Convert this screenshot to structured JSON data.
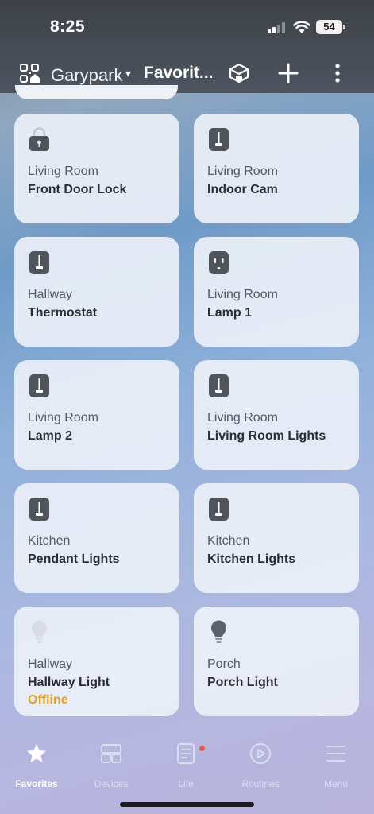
{
  "status_bar": {
    "time": "8:25",
    "battery": "54"
  },
  "nav": {
    "home_name": "Garypark",
    "caret": "▾",
    "title": "Favorit..."
  },
  "devices": [
    {
      "room": "Living Room",
      "name": "Front Door Lock",
      "icon": "lock-icon",
      "status": ""
    },
    {
      "room": "Living Room",
      "name": "Indoor Cam",
      "icon": "switch-icon",
      "status": ""
    },
    {
      "room": "Hallway",
      "name": "Thermostat",
      "icon": "switch-icon",
      "status": ""
    },
    {
      "room": "Living Room",
      "name": "Lamp 1",
      "icon": "outlet-icon",
      "status": ""
    },
    {
      "room": "Living Room",
      "name": "Lamp 2",
      "icon": "switch-icon",
      "status": ""
    },
    {
      "room": "Living Room",
      "name": "Living Room Lights",
      "icon": "switch-icon",
      "status": ""
    },
    {
      "room": "Kitchen",
      "name": "Pendant Lights",
      "icon": "switch-icon",
      "status": ""
    },
    {
      "room": "Kitchen",
      "name": "Kitchen Lights",
      "icon": "switch-icon",
      "status": ""
    },
    {
      "room": "Hallway",
      "name": "Hallway Light",
      "icon": "bulb-icon",
      "status": "Offline"
    },
    {
      "room": "Porch",
      "name": "Porch Light",
      "icon": "bulb-icon",
      "status": ""
    }
  ],
  "tabs": [
    {
      "label": "Favorites",
      "icon": "star-icon",
      "active": true
    },
    {
      "label": "Devices",
      "icon": "devices-icon",
      "active": false
    },
    {
      "label": "Life",
      "icon": "life-icon",
      "active": false
    },
    {
      "label": "Routines",
      "icon": "play-icon",
      "active": false
    },
    {
      "label": "Menu",
      "icon": "menu-icon",
      "active": false
    }
  ],
  "colors": {
    "offline": "#e4a31d",
    "notification": "#f05a3a"
  }
}
